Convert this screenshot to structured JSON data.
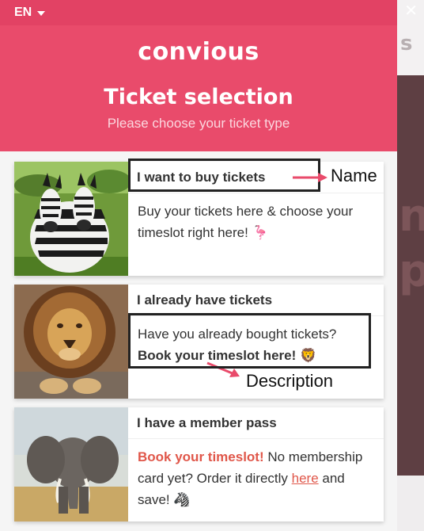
{
  "language": {
    "selected": "EN"
  },
  "brand": "convious",
  "header": {
    "title": "Ticket selection",
    "subtitle": "Please choose your ticket type"
  },
  "close_label": "✕",
  "background": {
    "letter": "s",
    "big_1": "n",
    "big_2": "p"
  },
  "tickets": [
    {
      "name": "I want to buy tickets",
      "desc": "Buy your tickets here & choose your timeslot right here!",
      "emoji": "🦩"
    },
    {
      "name": "I already have tickets",
      "desc_line1": "Have you already bought tickets?",
      "desc_bold": "Book your timeslot here!",
      "emoji": "🦁"
    },
    {
      "name": "I have a member pass",
      "desc_red": "Book your timeslot!",
      "desc_mid": " No membership card yet? Order it directly ",
      "desc_link": "here",
      "desc_end": " and save!",
      "emoji": "🦓"
    }
  ],
  "annotations": {
    "name_label": "Name",
    "description_label": "Description"
  },
  "colors": {
    "brand": "#e94b6b",
    "annotation_arrow": "#e94b6b",
    "accent_text": "#e0574a"
  }
}
